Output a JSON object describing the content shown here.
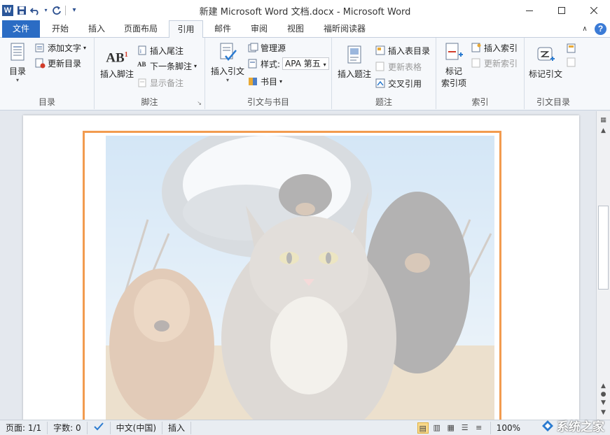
{
  "window": {
    "title": "新建 Microsoft Word 文档.docx - Microsoft Word"
  },
  "qat": {
    "app_icon": "W"
  },
  "tabs": [
    {
      "label": "文件"
    },
    {
      "label": "开始"
    },
    {
      "label": "插入"
    },
    {
      "label": "页面布局"
    },
    {
      "label": "引用"
    },
    {
      "label": "邮件"
    },
    {
      "label": "审阅"
    },
    {
      "label": "视图"
    },
    {
      "label": "福昕阅读器"
    }
  ],
  "ribbon": {
    "toc": {
      "toc_label": "目录",
      "add_text": "添加文字",
      "update_toc": "更新目录",
      "group": "目录"
    },
    "footnotes": {
      "insert_footnote": "插入脚注",
      "footnote_icon": "AB",
      "footnote_sup": "1",
      "insert_endnote": "插入尾注",
      "next_footnote": "下一条脚注",
      "show_notes": "显示备注",
      "group": "脚注"
    },
    "citations": {
      "insert_citation": "插入引文",
      "manage_sources": "管理源",
      "style_label": "样式:",
      "style_value": "APA 第五",
      "bibliography": "书目",
      "group": "引文与书目"
    },
    "captions": {
      "insert_caption": "插入题注",
      "insert_tof": "插入表目录",
      "update_table": "更新表格",
      "cross_ref": "交叉引用",
      "group": "题注"
    },
    "index": {
      "mark_entry_1": "标记",
      "mark_entry_2": "索引项",
      "insert_index": "插入索引",
      "update_index": "更新索引",
      "group": "索引"
    },
    "toa": {
      "mark_citation": "标记引文",
      "group": "引文目录"
    }
  },
  "status": {
    "page": "页面: 1/1",
    "words": "字数: 0",
    "language": "中文(中国)",
    "mode": "插入",
    "zoom": "100%"
  },
  "watermark": {
    "text": "系统之家"
  },
  "colors": {
    "file_tab": "#2b6cc4",
    "image_border": "#f29b4f",
    "word_blue": "#2b579a"
  }
}
